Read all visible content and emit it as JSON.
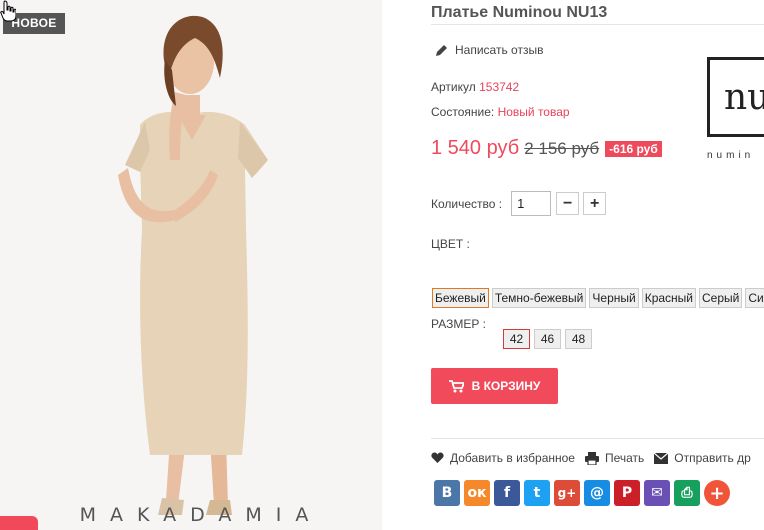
{
  "product_image": {
    "badge": "НОВОЕ",
    "brand_watermark": "MAKADAMIA"
  },
  "product": {
    "title": "Платье Numinou NU13",
    "review_link": "Написать отзыв",
    "sku_label": "Артикул",
    "sku_value": "153742",
    "condition_label": "Состояние:",
    "condition_value": "Новый товар",
    "price_current": "1 540 руб",
    "price_old": "2 156 руб",
    "discount": "-616 руб",
    "brand_logo_text": "nu",
    "brand_logo_sub": "numin"
  },
  "quantity": {
    "label": "Количество :",
    "value": "1",
    "minus": "−",
    "plus": "+"
  },
  "color": {
    "label": "ЦВЕТ :",
    "options": [
      "Бежевый",
      "Темно-бежевый",
      "Черный",
      "Красный",
      "Серый",
      "Си"
    ],
    "selected": "Бежевый"
  },
  "size": {
    "label": "РАЗМЕР :",
    "options": [
      "42",
      "46",
      "48"
    ],
    "selected": "42"
  },
  "cart_button": "В КОРЗИНУ",
  "actions": {
    "wishlist": "Добавить в избранное",
    "print": "Печать",
    "send": "Отправить др"
  },
  "share": [
    {
      "icon": "vk-icon",
      "label": "В",
      "color": "#4a76a8"
    },
    {
      "icon": "odnoklassniki-icon",
      "label": "ок",
      "color": "#f4882a"
    },
    {
      "icon": "facebook-icon",
      "label": "f",
      "color": "#3b5998"
    },
    {
      "icon": "twitter-icon",
      "label": "t",
      "color": "#1da1f2"
    },
    {
      "icon": "google-plus-icon",
      "label": "g+",
      "color": "#dd4b39"
    },
    {
      "icon": "mail-ru-icon",
      "label": "@",
      "color": "#168de2"
    },
    {
      "icon": "pinterest-icon",
      "label": "P",
      "color": "#cb2027"
    },
    {
      "icon": "email-icon",
      "label": "✉",
      "color": "#6a4fb5"
    },
    {
      "icon": "print-icon",
      "label": "⎙",
      "color": "#17a05d"
    },
    {
      "icon": "more-icon",
      "label": "+",
      "color": "#f0553a"
    }
  ],
  "colors": {
    "accent": "#ef4a5c",
    "badge_bg": "#555555"
  }
}
